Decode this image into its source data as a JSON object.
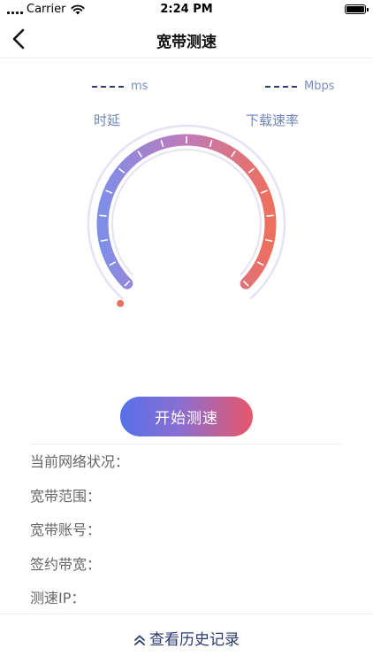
{
  "status_bar": {
    "carrier": "Carrier",
    "time": "2:24 PM"
  },
  "nav": {
    "title": "宽带测速"
  },
  "metrics": {
    "latency": {
      "value": "",
      "unit": "ms",
      "label": "时延"
    },
    "download": {
      "value": "",
      "unit": "Mbps",
      "label": "下载速率"
    }
  },
  "gauge": {
    "gradient_start": "#7f8ee8",
    "gradient_mid": "#c07ab8",
    "gradient_end": "#ee6f5e",
    "track_color": "#e6e2f5",
    "indicator_color": "#e8705e"
  },
  "actions": {
    "start_label": "开始测速"
  },
  "info": {
    "rows": [
      {
        "label": "当前网络状况："
      },
      {
        "label": "宽带范围："
      },
      {
        "label": "宽带账号："
      },
      {
        "label": "签约带宽："
      },
      {
        "label": "测速IP："
      }
    ]
  },
  "footer": {
    "history_label": "查看历史记录"
  }
}
